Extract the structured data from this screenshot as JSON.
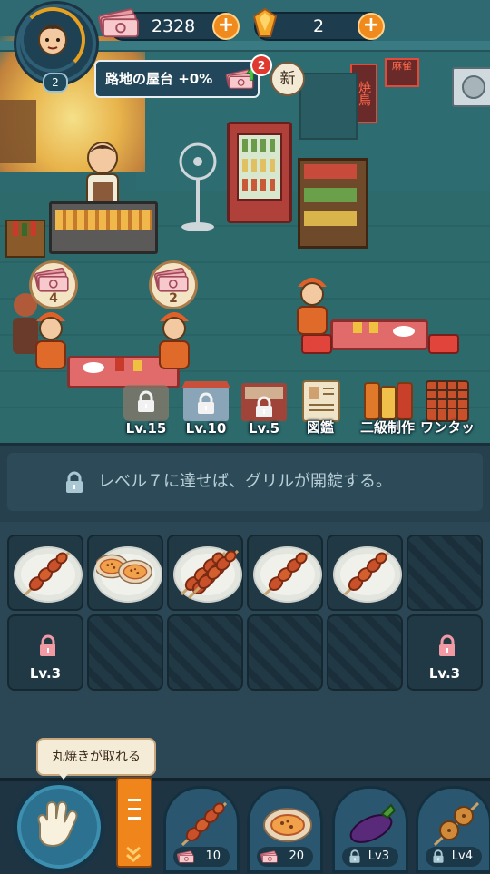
{
  "hud": {
    "level": "2",
    "cash": "2328",
    "gems": "2",
    "plus_symbol": "+"
  },
  "location": {
    "name_bonus": "路地の屋台 +0%",
    "notification_count": "2",
    "new_label": "新"
  },
  "scene": {
    "sign_yakitori": "焼鳥",
    "sign_mahjong": "麻雀",
    "customer_bubbles": [
      {
        "amount": "4"
      },
      {
        "amount": "2"
      }
    ]
  },
  "features": [
    {
      "label": "Lv.15",
      "icon": "lock-icon",
      "locked": true
    },
    {
      "label": "Lv.10",
      "icon": "lock-icon",
      "locked": true
    },
    {
      "label": "Lv.5",
      "icon": "lock-icon",
      "locked": true
    },
    {
      "label": "図鑑",
      "icon": "book-icon",
      "locked": false
    },
    {
      "label": "二級制作",
      "icon": "jars-icon",
      "locked": false
    },
    {
      "label": "ワンタッ",
      "icon": "grill-rack-icon",
      "locked": false
    }
  ],
  "lock_banner": {
    "message": "レベル７に達せば、グリルが開錠する。"
  },
  "grill_slots": {
    "row1": [
      {
        "content": "skewer",
        "state": "cooking"
      },
      {
        "content": "oyster",
        "state": "cooking"
      },
      {
        "content": "skewer-double",
        "state": "cooking"
      },
      {
        "content": "skewer",
        "state": "cooking"
      },
      {
        "content": "skewer",
        "state": "cooking"
      },
      {
        "content": "",
        "state": "empty"
      }
    ],
    "row2": [
      {
        "label": "Lv.3",
        "state": "locked"
      },
      {
        "label": "",
        "state": "empty"
      },
      {
        "label": "",
        "state": "empty"
      },
      {
        "label": "",
        "state": "empty"
      },
      {
        "label": "",
        "state": "empty"
      },
      {
        "label": "Lv.3",
        "state": "locked"
      }
    ]
  },
  "bottom": {
    "hint": "丸焼きが取れる",
    "foods": [
      {
        "name": "skewer",
        "price": "10",
        "locked": false
      },
      {
        "name": "oyster",
        "price": "20",
        "locked": false
      },
      {
        "name": "eggplant",
        "price": "Lv3",
        "locked": true
      },
      {
        "name": "lotus-root",
        "price": "Lv4",
        "locked": true
      }
    ]
  },
  "colors": {
    "accent_orange": "#f08a1c",
    "badge_red": "#e03a30",
    "panel_dark": "#213845"
  }
}
